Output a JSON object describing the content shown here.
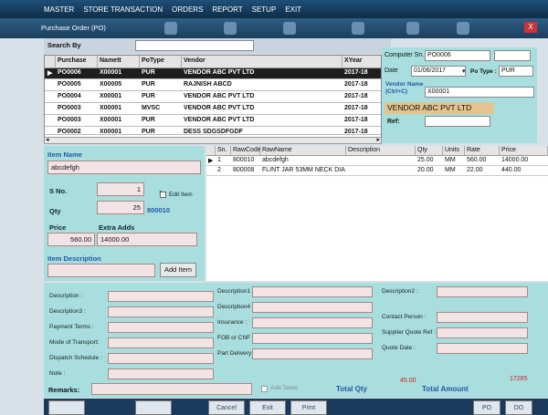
{
  "menu": [
    "MASTER",
    "STORE TRANSACTION",
    "ORDERS",
    "REPORT",
    "SETUP",
    "EXIT"
  ],
  "window": {
    "title": "Purchase Order (PO)",
    "close": "X"
  },
  "search": {
    "label": "Search By",
    "value": ""
  },
  "po_grid": {
    "columns": [
      "Purchase",
      "Namett",
      "PoType",
      "Vendor",
      "XYear"
    ],
    "rows": [
      {
        "purchase": "PO0006",
        "name": "X00001",
        "type": "PUR",
        "vendor": "VENDOR ABC PVT LTD",
        "year": "2017-18",
        "marker": "▶"
      },
      {
        "purchase": "PO0005",
        "name": "X00005",
        "type": "PUR",
        "vendor": "RAJNISH ABCD",
        "year": "2017-18",
        "marker": ""
      },
      {
        "purchase": "PO0004",
        "name": "X00001",
        "type": "PUR",
        "vendor": "VENDOR ABC PVT LTD",
        "year": "2017-18",
        "marker": ""
      },
      {
        "purchase": "PO0003",
        "name": "X00001",
        "type": "MVSC",
        "vendor": "VENDOR ABC PVT LTD",
        "year": "2017-18",
        "marker": ""
      },
      {
        "purchase": "PO0003",
        "name": "X00001",
        "type": "PUR",
        "vendor": "VENDOR ABC PVT LTD",
        "year": "2017-18",
        "marker": ""
      },
      {
        "purchase": "PO0002",
        "name": "X00001",
        "type": "PUR",
        "vendor": "DESS SDGSDFGDF",
        "year": "2017-18",
        "marker": ""
      }
    ]
  },
  "header_form": {
    "computer_sn_label": "Computer Sn.",
    "computer_sn": "PO0006",
    "date_label": "Date",
    "date": "01/06/2017",
    "po_type_label": "Po Type :",
    "po_type": "PUR",
    "vendor_name_label": "Vendor Name",
    "vendor_name_hint": "(Ctrl+C)",
    "vendor_code": "X00001",
    "vendor_display": "VENDOR ABC PVT LTD",
    "ref_label": "Ref:",
    "ref": ""
  },
  "item_form": {
    "item_name_label": "Item Name",
    "item_name": "abcdefgh",
    "sno_label": "S No.",
    "sno": "1",
    "edit_item_label": "Edit Item",
    "qty_label": "Qty",
    "qty": "25",
    "code": "800010",
    "price_label": "Price",
    "price": "560.00",
    "extra_label": "Extra Adds",
    "extra": "14000.00",
    "desc_label": "Item Description",
    "desc": "",
    "add_button": "Add Item"
  },
  "item_grid": {
    "columns": [
      "Sn.",
      "RawCode",
      "RawName",
      "Description",
      "Qty",
      "Units",
      "Rate",
      "Price"
    ],
    "rows": [
      {
        "marker": "▶",
        "sn": "1",
        "code": "800010",
        "name": "abcdefgh",
        "desc": "",
        "qty": "25.00",
        "units": "MM",
        "rate": "560.00",
        "price": "14000.00"
      },
      {
        "marker": "",
        "sn": "2",
        "code": "800008",
        "name": "FLINT JAR 53MM NECK DIA",
        "desc": "",
        "qty": "20.00",
        "units": "MM",
        "rate": "22.00",
        "price": "440.00"
      }
    ]
  },
  "bottom_form": {
    "description": "Description :",
    "description3": "Description3 :",
    "payment_terms": "Payment Terms :",
    "mode_transport": "Mode of Transport:",
    "dispatch_schedule": "Dispatch Schedule :",
    "note": "Note :",
    "description1": "Description1 :",
    "description4": "Description4 :",
    "insurance": "Insurance :",
    "fob": "FOB or CNF :",
    "part_delivery": "Part Delivery :",
    "description2": "Description2 :",
    "contact_person": "Contact Person :",
    "supplier_quote_ref": "Supplier Quote Ref :",
    "quote_date": "Quote Date :"
  },
  "totals": {
    "remarks_label": "Remarks:",
    "add_taxes_label": "Add Taxes",
    "total_qty_label": "Total Qty",
    "total_qty": "45.00",
    "total_amount_label": "Total Amount",
    "total_amount": "17285"
  },
  "footer_buttons": [
    "",
    "",
    "Cancel",
    "Exit",
    "Print",
    "PO",
    "DO"
  ]
}
